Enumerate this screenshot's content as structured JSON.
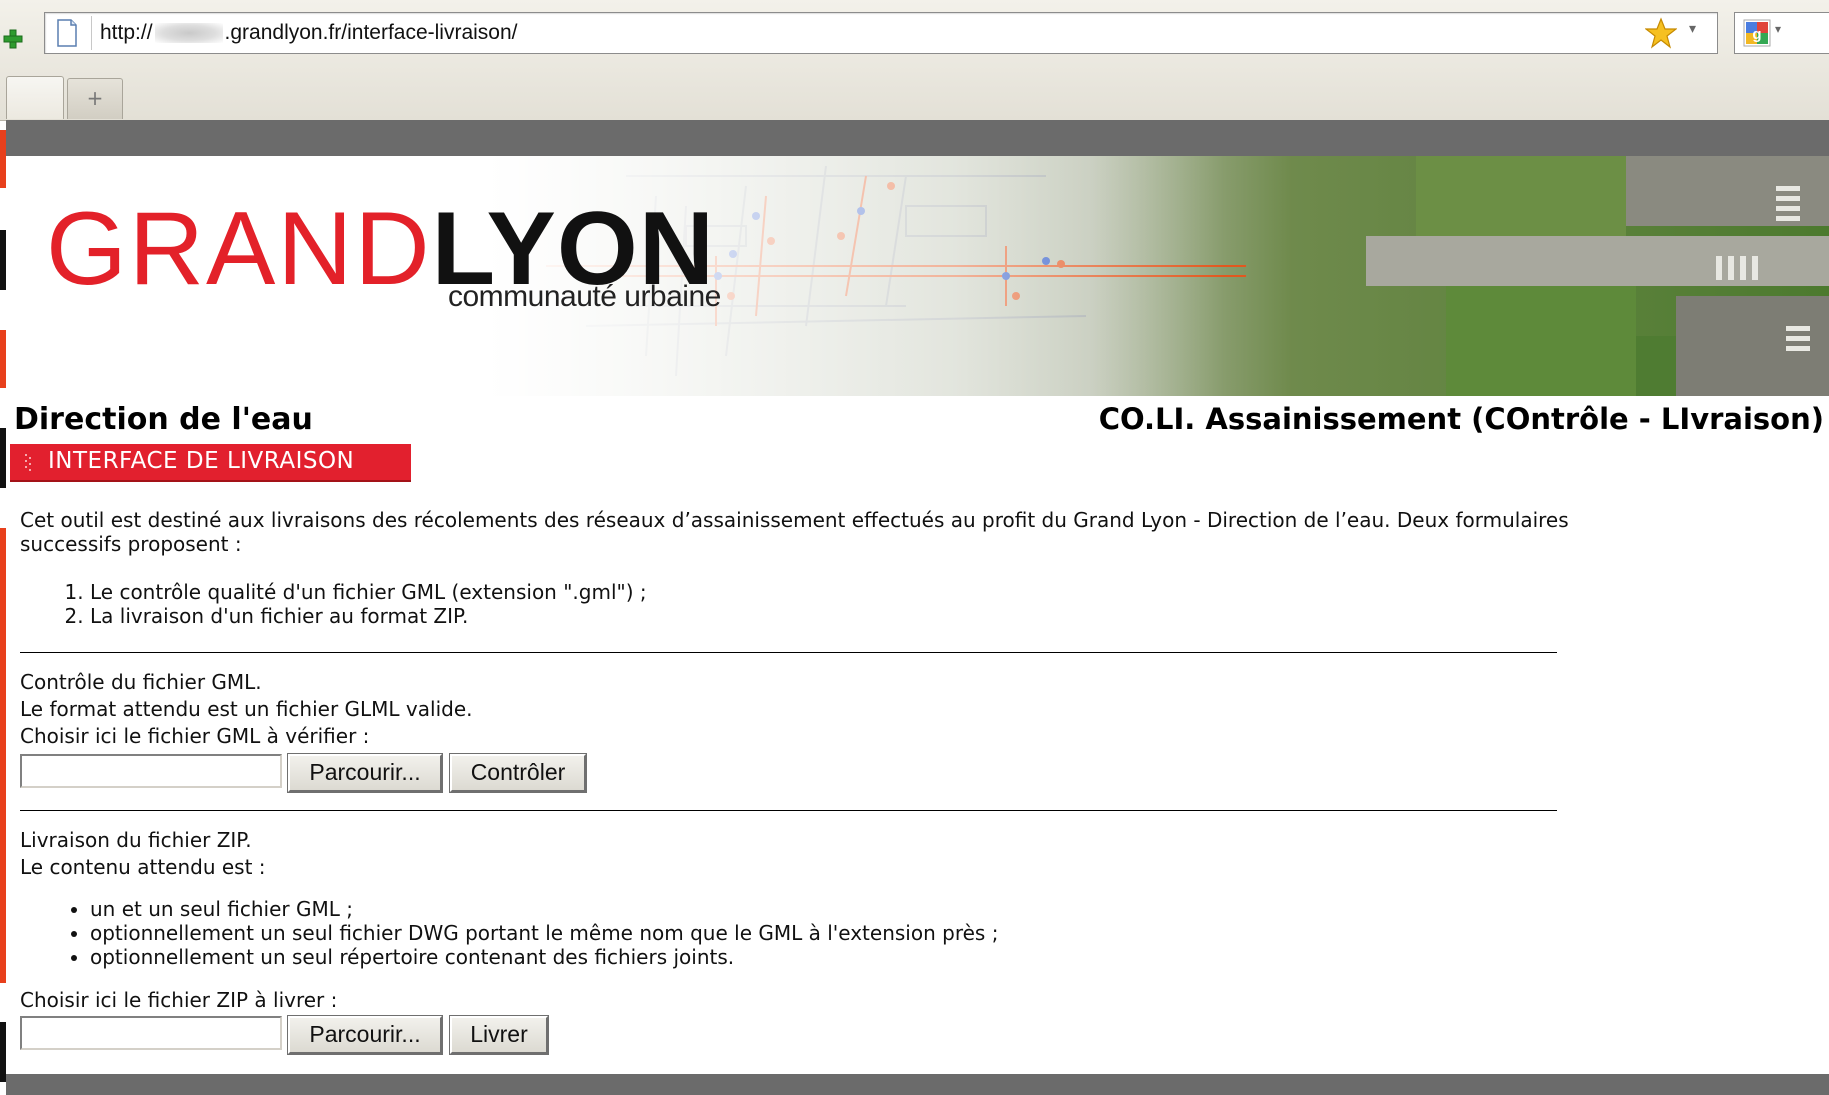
{
  "browser": {
    "url_prefix": "http://",
    "url_suffix": ".grandlyon.fr/interface-livraison/",
    "new_tab_symbol": "+",
    "dropdown_symbol": "▾"
  },
  "banner": {
    "logo_word_1": "GRAND",
    "logo_word_2": "LYON",
    "logo_subtitle": "communauté urbaine"
  },
  "header": {
    "department": "Direction de l'eau",
    "application": "CO.LI. Assainissement (COntrôle - LIvraison)"
  },
  "section": {
    "title": "INTERFACE DE LIVRAISON"
  },
  "intro": {
    "text": "Cet outil est destiné aux livraisons des récolements des réseaux d’assainissement effectués au profit du Grand Lyon - Direction de l’eau. Deux formulaires successifs proposent :",
    "steps": [
      "Le contrôle qualité d'un fichier GML (extension \".gml\") ;",
      "La livraison d'un fichier au format ZIP."
    ]
  },
  "gml_form": {
    "heading": "Contrôle du fichier GML.",
    "format_note": "Le format attendu est un fichier GLML valide.",
    "prompt": "Choisir ici le fichier GML à vérifier :",
    "file_value": "",
    "browse_label": "Parcourir...",
    "submit_label": "Contrôler"
  },
  "zip_form": {
    "heading": "Livraison du fichier ZIP.",
    "content_note": "Le contenu attendu est :",
    "requirements": [
      "un et un seul fichier GML ;",
      "optionnellement un seul fichier DWG portant le même nom que le GML à l'extension près ;",
      "optionnellement un seul répertoire contenant des fichiers joints."
    ],
    "prompt": "Choisir ici le fichier ZIP à livrer :",
    "file_value": "",
    "browse_label": "Parcourir...",
    "submit_label": "Livrer"
  },
  "colors": {
    "brand_red": "#e2202e",
    "band_grey": "#6b6b6b",
    "logo_red": "#e32129"
  },
  "icons": [
    "plus-icon",
    "page-icon",
    "bookmark-star-icon",
    "search-engine-icon",
    "chevron-down-icon"
  ]
}
